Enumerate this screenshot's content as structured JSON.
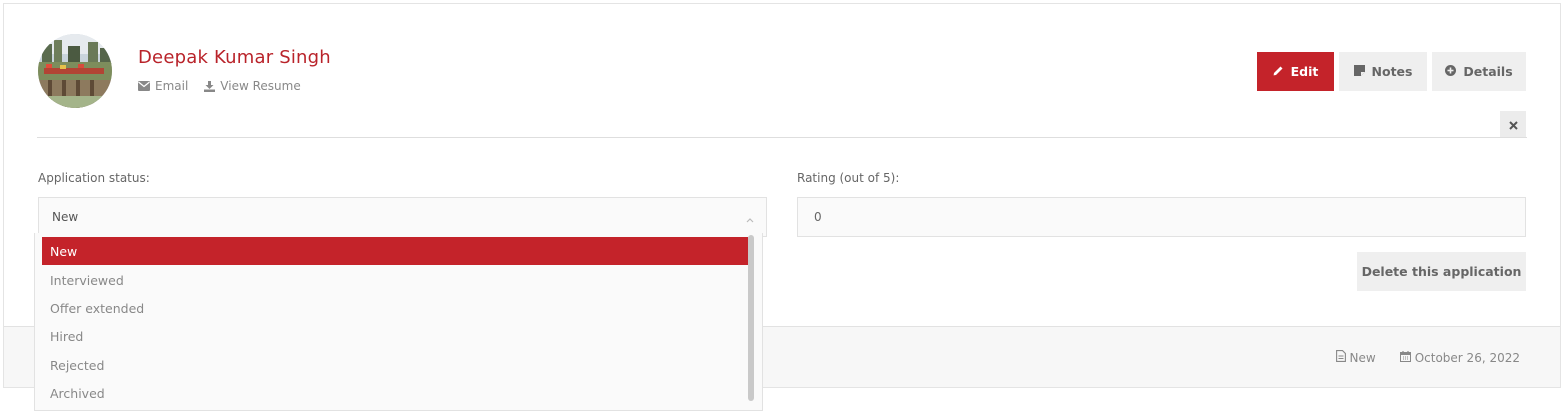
{
  "profile": {
    "name": "Deepak Kumar Singh",
    "email_label": "Email",
    "resume_label": "View Resume"
  },
  "actions": {
    "edit_label": "Edit",
    "notes_label": "Notes",
    "details_label": "Details",
    "delete_label": "Delete this application"
  },
  "status": {
    "label": "Application status:",
    "selected": "New",
    "options": [
      "New",
      "Interviewed",
      "Offer extended",
      "Hired",
      "Rejected",
      "Archived"
    ]
  },
  "rating": {
    "label": "Rating (out of 5):",
    "value": "0"
  },
  "footer": {
    "status_text": "New",
    "date_text": "October 26, 2022"
  },
  "colors": {
    "accent": "#c4232a",
    "button_gray": "#efefef"
  },
  "icons": [
    "envelope-icon",
    "download-icon",
    "pencil-icon",
    "note-icon",
    "plus-circle-icon",
    "close-icon",
    "chevron-up-icon",
    "file-icon",
    "calendar-icon"
  ]
}
